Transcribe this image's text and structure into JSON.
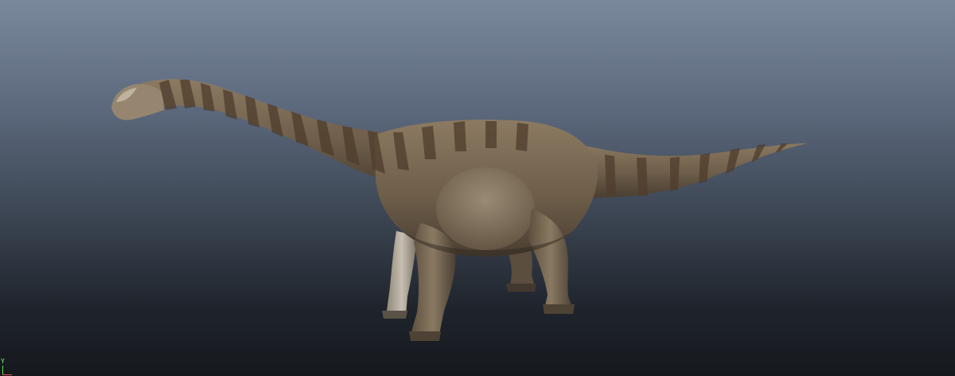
{
  "viewport": {
    "background_top": "#7a889d",
    "background_bottom": "#15181d"
  },
  "model": {
    "subject": "sauropod-dinosaur",
    "skin_base_color": "#7a6a55",
    "stripe_color": "#5a4634",
    "belly_color": "#b4ab9c"
  },
  "axis_gizmo": {
    "y_label": "Y",
    "y_color": "#53e253",
    "x_color": "#e25353"
  }
}
